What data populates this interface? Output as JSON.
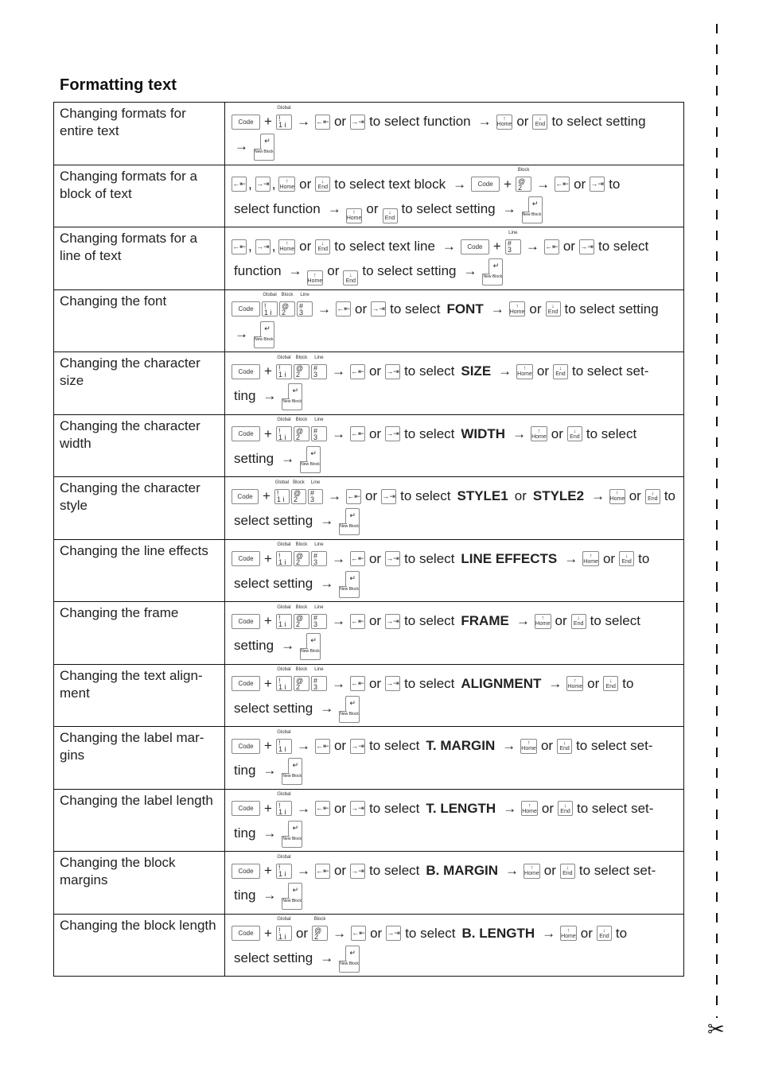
{
  "page": {
    "title": "Formatting text",
    "scissors_icon": "✂"
  },
  "keys": {
    "code": "Code",
    "global_cap": "Global",
    "block_cap": "Block",
    "line_cap": "Line",
    "key1_top": "!",
    "key1_bottom": "1  i",
    "key2_top": "@",
    "key2_bottom": "2",
    "key3_top": "#",
    "key3_bottom": "3",
    "left_glyph": "←⇤",
    "right_glyph": "→⇥",
    "home": "Home",
    "end": "End",
    "up_glyph": "↑",
    "down_glyph": "↓",
    "enter_glyph": "↵",
    "newblock": "New Block"
  },
  "words": {
    "plus": "+",
    "arrow": "→",
    "or": "or",
    "comma": ","
  },
  "rows": [
    {
      "label": "Changing formats for entire text",
      "text1": "to select function",
      "text2": "to select setting"
    },
    {
      "label": "Changing formats for a block of text",
      "text1": "to select text block",
      "text2": "to",
      "text3": "select function",
      "text4": "to select setting"
    },
    {
      "label": "Changing formats for a line of text",
      "text1": "to select text line",
      "text2": "to select",
      "text3": "function",
      "text4": "to select setting"
    },
    {
      "label": "Changing the font",
      "text1": "to select",
      "bold": "FONT",
      "text2": "to select setting"
    },
    {
      "label": "Changing the character size",
      "text1": "to select",
      "bold": "SIZE",
      "text2": "to select set-",
      "text3": "ting"
    },
    {
      "label": "Changing the character width",
      "text1": "to select",
      "bold": "WIDTH",
      "text2": "to select",
      "text3": "setting"
    },
    {
      "label": "Changing the character style",
      "text1": "to select",
      "bold": "STYLE1",
      "mid": "or",
      "bold2": "STYLE2",
      "text2": "to",
      "text3": "select setting"
    },
    {
      "label": "Changing the line effects",
      "text1": "to select",
      "bold": "LINE EFFECTS",
      "text2": "to",
      "text3": "select setting"
    },
    {
      "label": "Changing the frame",
      "text1": "to select",
      "bold": "FRAME",
      "text2": "to select",
      "text3": "setting"
    },
    {
      "label": "Changing the text align-ment",
      "text1": "to select",
      "bold": "ALIGNMENT",
      "text2": "to",
      "text3": "select setting"
    },
    {
      "label": "Changing the label mar-gins",
      "text1": "to select",
      "bold": "T. MARGIN",
      "text2": "to select set-",
      "text3": "ting"
    },
    {
      "label": "Changing the label length",
      "text1": "to select",
      "bold": "T. LENGTH",
      "text2": "to select set-",
      "text3": "ting"
    },
    {
      "label": "Changing the block margins",
      "text1": "to select",
      "bold": "B. MARGIN",
      "text2": "to select set-",
      "text3": "ting"
    },
    {
      "label": "Changing the block length",
      "text1": "to select",
      "bold": "B. LENGTH",
      "text2": "to",
      "text3": "select setting"
    }
  ]
}
